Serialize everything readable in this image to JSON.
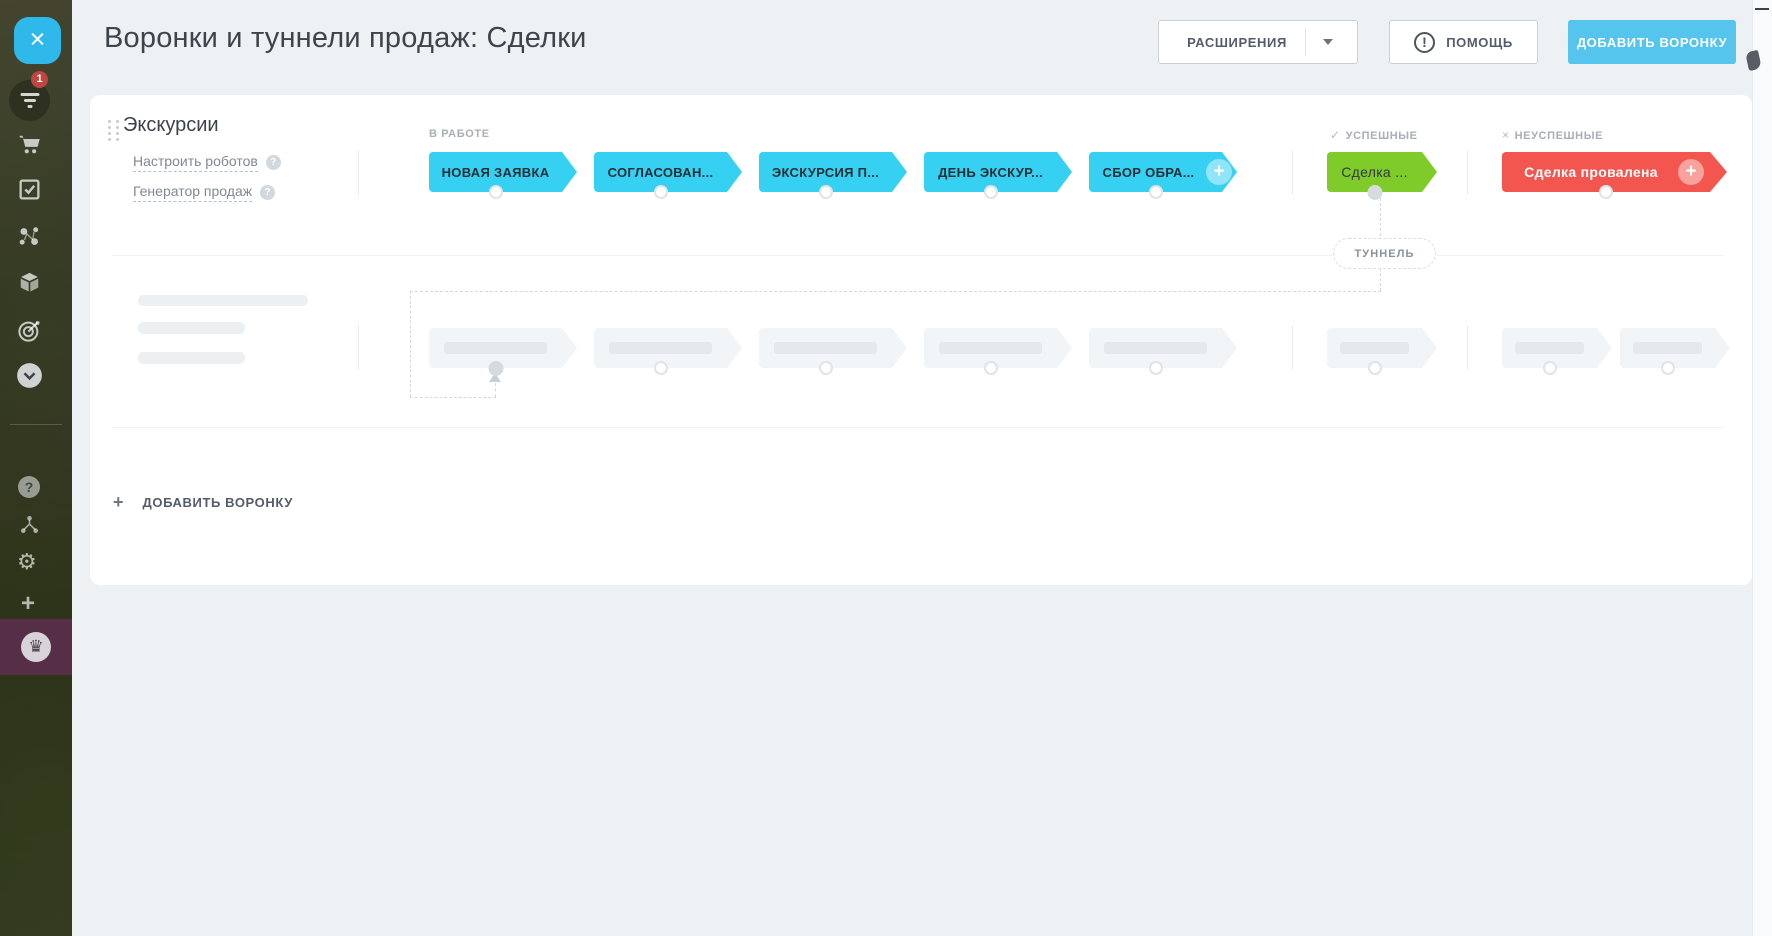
{
  "page": {
    "title": "Воронки и туннели продаж: Сделки"
  },
  "header": {
    "extensions_label": "РАСШИРЕНИЯ",
    "help_label": "ПОМОЩЬ",
    "add_button_label": "ДОБАВИТЬ ВОРОНКУ"
  },
  "sidebar": {
    "notification_count": "1",
    "icons": [
      "close-menu",
      "funnel-notifications",
      "cart",
      "tasks",
      "crm-network",
      "catalog-cube",
      "marketing-target",
      "more-chevron",
      "help-question",
      "share-nodes",
      "settings-gear",
      "add-plus",
      "subscription-crown"
    ]
  },
  "funnel": {
    "name": "Экскурсии",
    "robots_link": "Настроить роботов",
    "generator_link": "Генератор продаж",
    "columns": {
      "in_progress": "В РАБОТЕ",
      "success": "УСПЕШНЫЕ",
      "fail": "НЕУСПЕШНЫЕ"
    },
    "stages": [
      {
        "label": "НОВАЯ ЗАЯВКА",
        "color": "#35d0f2"
      },
      {
        "label": "СОГЛАСОВАН...",
        "color": "#35d0f2"
      },
      {
        "label": "ЭКСКУРСИЯ П...",
        "color": "#35d0f2"
      },
      {
        "label": "ДЕНЬ ЭКСКУР...",
        "color": "#35d0f2"
      },
      {
        "label": "СБОР ОБРА...",
        "color": "#35d0f2"
      }
    ],
    "success_stage": {
      "label": "Сделка ...",
      "color": "#7ecb29"
    },
    "fail_stage": {
      "label": "Сделка провалена",
      "color": "#f2564e"
    },
    "tunnel_label": "ТУННЕЛЬ"
  },
  "footer": {
    "add_funnel_label": "ДОБАВИТЬ ВОРОНКУ"
  },
  "colors": {
    "accent_blue": "#55c5ee",
    "stage_cyan": "#35d0f2",
    "stage_green": "#7ecb29",
    "stage_red": "#f2564e",
    "badge_red": "#bf4541",
    "page_bg": "#edf1f4"
  }
}
